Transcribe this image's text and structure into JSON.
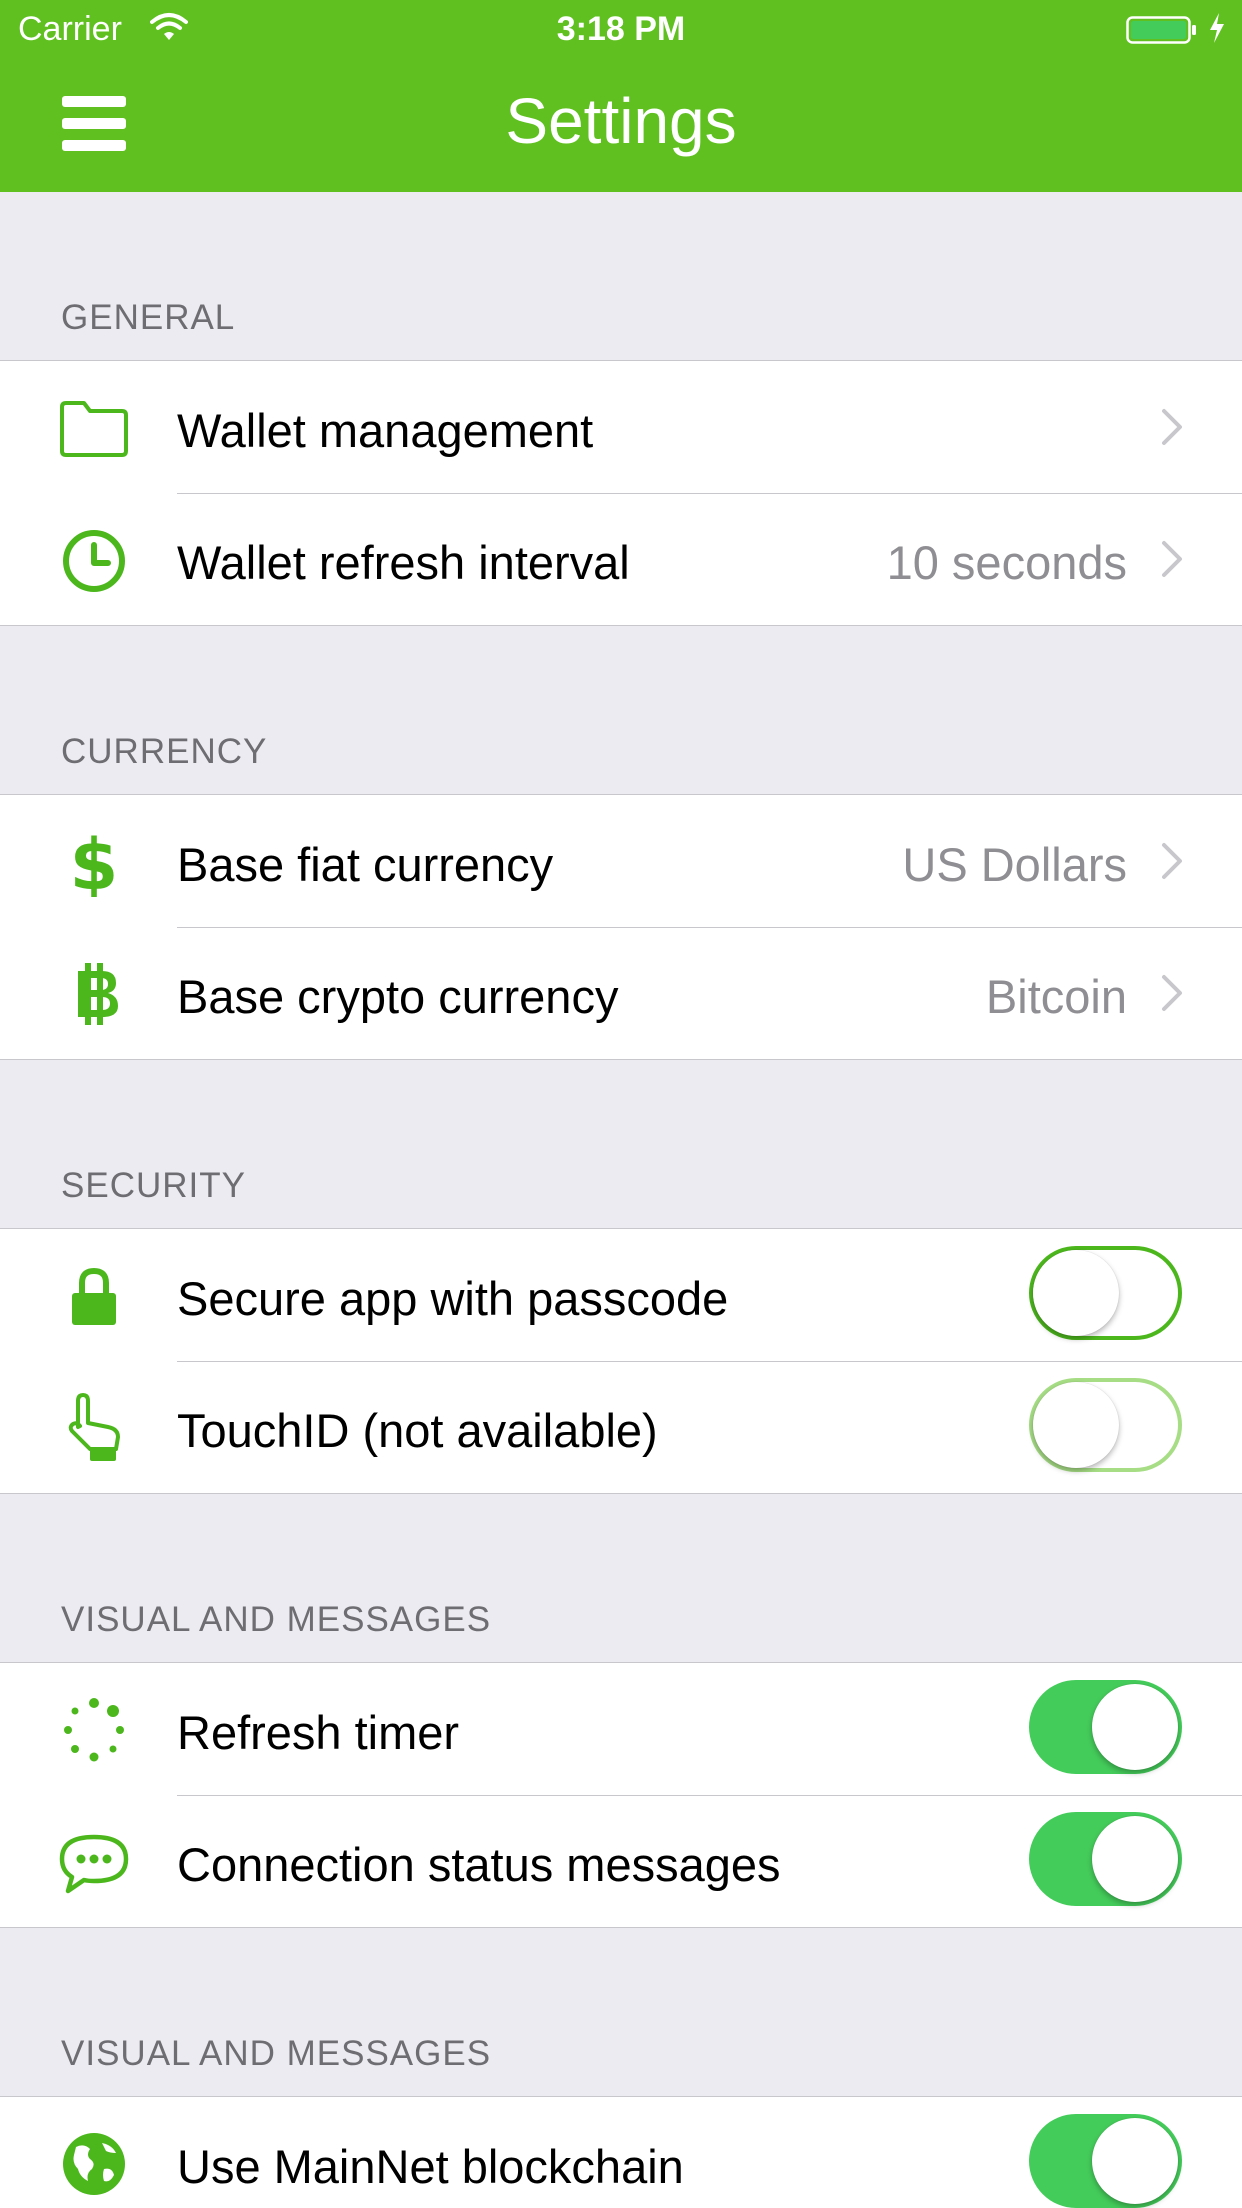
{
  "status_bar": {
    "carrier": "Carrier",
    "time": "3:18 PM"
  },
  "nav": {
    "title": "Settings"
  },
  "colors": {
    "brand_green": "#5fc01f",
    "icon_green": "#4cb71d",
    "toggle_on": "#44cc5a"
  },
  "sections": {
    "general": {
      "header": "GENERAL",
      "rows": [
        {
          "icon": "folder-icon",
          "label": "Wallet management",
          "value": ""
        },
        {
          "icon": "clock-icon",
          "label": "Wallet refresh interval",
          "value": "10 seconds"
        }
      ]
    },
    "currency": {
      "header": "CURRENCY",
      "rows": [
        {
          "icon": "dollar-icon",
          "label": "Base fiat currency",
          "value": "US Dollars"
        },
        {
          "icon": "bitcoin-icon",
          "label": "Base crypto currency",
          "value": "Bitcoin"
        }
      ]
    },
    "security": {
      "header": "SECURITY",
      "rows": [
        {
          "icon": "lock-icon",
          "label": "Secure app with passcode",
          "toggle": false
        },
        {
          "icon": "touch-hand-icon",
          "label": "TouchID (not available)",
          "toggle": false,
          "disabled": true
        }
      ]
    },
    "visual": {
      "header": "VISUAL AND MESSAGES",
      "rows": [
        {
          "icon": "spinner-dots-icon",
          "label": "Refresh timer",
          "toggle": true
        },
        {
          "icon": "chat-bubble-icon",
          "label": "Connection status messages",
          "toggle": true
        }
      ]
    },
    "network": {
      "header": "VISUAL AND MESSAGES",
      "rows": [
        {
          "icon": "globe-icon",
          "label": "Use MainNet blockchain",
          "toggle": true
        }
      ]
    }
  }
}
